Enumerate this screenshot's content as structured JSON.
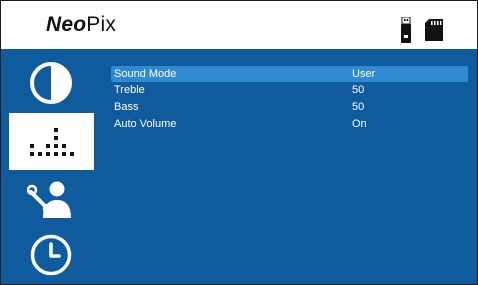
{
  "header": {
    "logo_bold": "Neo",
    "logo_light": "Pix"
  },
  "status_icons": [
    "usb-drive-icon",
    "sd-card-icon"
  ],
  "sidebar": {
    "items": [
      {
        "name": "picture",
        "icon": "contrast-icon",
        "active": false
      },
      {
        "name": "sound",
        "icon": "equalizer-icon",
        "active": true
      },
      {
        "name": "settings",
        "icon": "user-tools-icon",
        "active": false
      },
      {
        "name": "time",
        "icon": "clock-icon",
        "active": false
      }
    ]
  },
  "menu": {
    "rows": [
      {
        "label": "Sound Mode",
        "value": "User",
        "selected": true
      },
      {
        "label": "Treble",
        "value": "50",
        "selected": false
      },
      {
        "label": "Bass",
        "value": "50",
        "selected": false
      },
      {
        "label": "Auto Volume",
        "value": "On",
        "selected": false
      }
    ]
  },
  "colors": {
    "panel_blue": "#0f5b9d",
    "highlight_blue": "#2f8ad2",
    "text": "#ffffff"
  }
}
